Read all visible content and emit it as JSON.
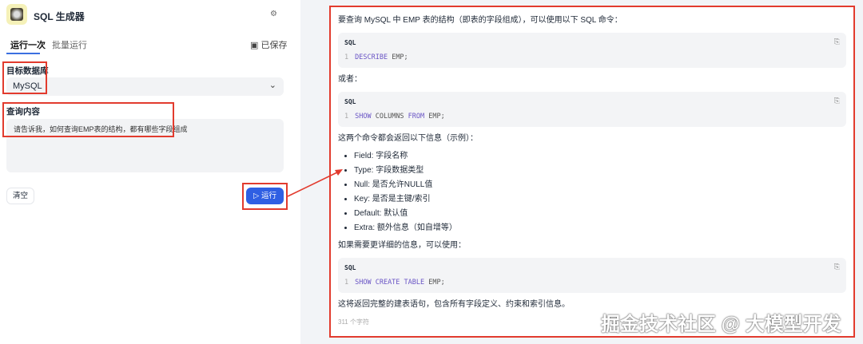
{
  "app": {
    "title": "SQL 生成器"
  },
  "tabs": [
    {
      "label": "运行一次"
    },
    {
      "label": "批量运行"
    }
  ],
  "saved_label": "已保存",
  "form": {
    "db_label": "目标数据库",
    "db_value": "MySQL",
    "query_label": "查询内容",
    "query_value": "请告诉我，如何查询EMP表的结构，都有哪些字段组成"
  },
  "buttons": {
    "clear": "清空",
    "run": "运行"
  },
  "result": {
    "intro": "要查询 MySQL 中 EMP 表的结构（即表的字段组成），可以使用以下 SQL 命令：",
    "code1": {
      "lang": "SQL",
      "ln": "1",
      "kw": "DESCRIBE",
      "rest": " EMP;"
    },
    "or": "或者：",
    "code2": {
      "lang": "SQL",
      "ln": "1",
      "kw1": "SHOW",
      "mid": " COLUMNS ",
      "kw2": "FROM",
      "rest": " EMP;"
    },
    "returns": "这两个命令都会返回以下信息（示例）：",
    "items": [
      "Field: 字段名称",
      "Type: 字段数据类型",
      "Null: 是否允许NULL值",
      "Key: 是否是主键/索引",
      "Default: 默认值",
      "Extra: 额外信息（如自增等）"
    ],
    "detail": "如果需要更详细的信息，可以使用：",
    "code3": {
      "lang": "SQL",
      "ln": "1",
      "kw": "SHOW CREATE TABLE",
      "rest": " EMP;"
    },
    "outro": "这将返回完整的建表语句，包含所有字段定义、约束和索引信息。",
    "count": "311 个字符"
  },
  "watermark": "掘金技术社区 @ 大模型开发"
}
